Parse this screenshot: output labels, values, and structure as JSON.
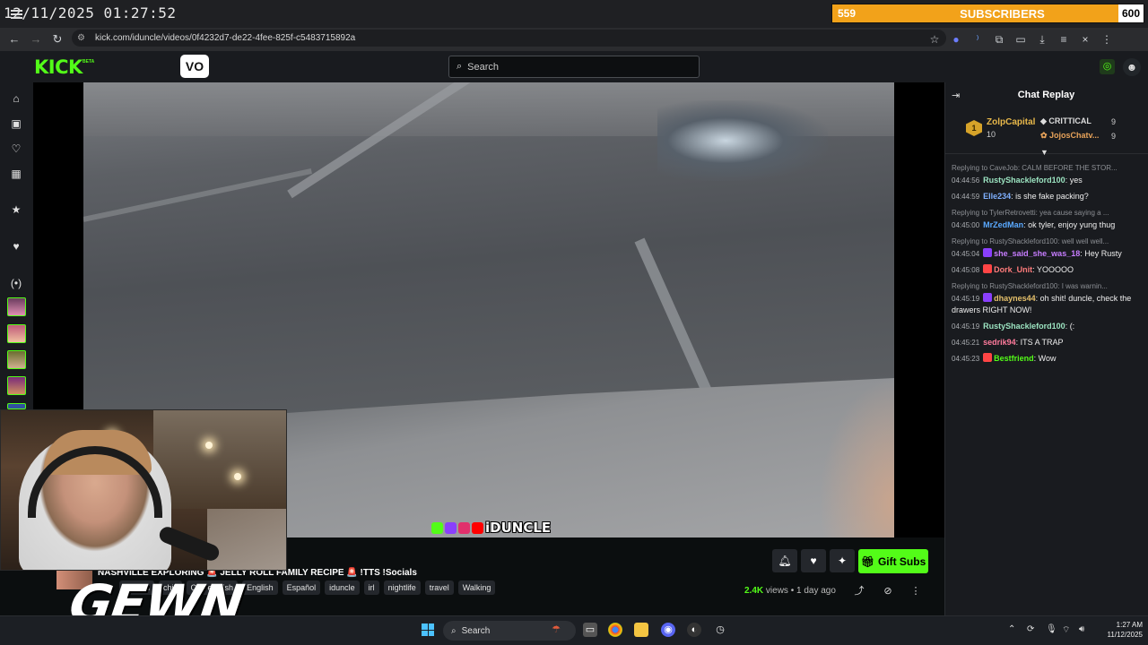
{
  "overlay": {
    "timestamp": "12/11/2025 01:27:52",
    "subscriber_goal": {
      "current": "559",
      "label": "SUBSCRIBERS",
      "goal": "600"
    },
    "brand_watermark": "GEWN"
  },
  "browser": {
    "url": "kick.com/iduncle/videos/0f4232d7-de22-4fee-825f-c5483715892a",
    "nav_icons": [
      "back-icon",
      "forward-icon",
      "reload-icon",
      "site-info-icon"
    ],
    "toolbar_icons": [
      "bookmark-star-icon",
      "extension-icon",
      "extension-icon",
      "puzzle-icon",
      "split-icon",
      "download-icon",
      "reading-list-icon",
      "close-icon",
      "menu-kebab-icon"
    ]
  },
  "header": {
    "logo": "KICK",
    "logo_badge": "BETA",
    "vo_button": "VO",
    "search_placeholder": "Search"
  },
  "rail": {
    "icons": [
      "home-icon",
      "browse-icon",
      "following-icon",
      "categories-icon",
      "star-icon",
      "heart-icon",
      "live-icon"
    ]
  },
  "video": {
    "watermark": "iDUNCLE",
    "title": "NASHVILLE EXPLORING 🚨 JELLY ROLL FAMILY RECIPE 🚨 !TTS !Socials",
    "language_prefix": "IRL",
    "tags": [
      "English",
      "chill",
      "Cx - english",
      "English",
      "Español",
      "iduncle",
      "irl",
      "nightlife",
      "travel",
      "Walking"
    ],
    "views_count": "2.4K",
    "views_label": "views",
    "separator": "•",
    "age": "1 day ago",
    "gift_button": "Gift Subs"
  },
  "chat": {
    "title": "Chat Replay",
    "leaderboard": {
      "rank": "1",
      "top_user": "ZolpCapital",
      "top_value": "10",
      "second_user": "CRITTICAL",
      "second_value": "9",
      "third_user": "JojosChatv...",
      "third_value": "9"
    },
    "messages": [
      {
        "reply": "Replying to CaveJob: CALM BEFORE THE STOR...",
        "time": "04:44:56",
        "user": "RustyShackleford100",
        "color": "#9be3c0",
        "text": ": yes",
        "badge": ""
      },
      {
        "reply": "",
        "time": "04:44:59",
        "user": "Elle234",
        "color": "#7fb0ff",
        "text": ": is she fake packing?",
        "badge": ""
      },
      {
        "reply": "Replying to TylerRetrovetti: yea cause saying a ...",
        "time": "04:45:00",
        "user": "MrZedMan",
        "color": "#5aa9ff",
        "text": ": ok tyler, enjoy yung thug",
        "badge": ""
      },
      {
        "reply": "Replying to RustyShackleford100: well well well...",
        "time": "04:45:04",
        "user": "she_said_she_was_18",
        "color": "#c77dff",
        "text": ": Hey Rusty",
        "badge": "#8a3ffc"
      },
      {
        "reply": "",
        "time": "04:45:08",
        "user": "Dork_Unit",
        "color": "#ff7b7b",
        "text": ": YOOOOO",
        "badge": "#ff4545"
      },
      {
        "reply": "Replying to RustyShackleford100: I was warnin...",
        "time": "04:45:19",
        "user": "dhaynes44",
        "color": "#e6c16b",
        "text": ": oh shit! duncle, check the drawers RIGHT NOW!",
        "badge": "#8a3ffc"
      },
      {
        "reply": "",
        "time": "04:45:19",
        "user": "RustyShackleford100",
        "color": "#9be3c0",
        "text": ": (:",
        "badge": ""
      },
      {
        "reply": "",
        "time": "04:45:21",
        "user": "sedrik94",
        "color": "#ff7b9c",
        "text": ": ITS A TRAP",
        "badge": ""
      },
      {
        "reply": "",
        "time": "04:45:23",
        "user": "Bestfriend",
        "color": "#53fc18",
        "text": ": Wow",
        "badge": "#ff4545"
      }
    ]
  },
  "taskbar": {
    "search_label": "Search",
    "time": "1:27 AM",
    "date": "11/12/2025"
  }
}
